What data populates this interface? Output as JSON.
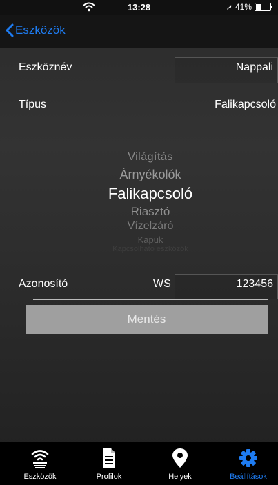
{
  "status_bar": {
    "time": "13:28",
    "battery_text": "41%",
    "battery_level": 0.41
  },
  "nav": {
    "back_label": "Eszközök"
  },
  "form": {
    "name_label": "Eszköznév",
    "name_value": "Nappali",
    "type_label": "Típus",
    "type_value": "Falikapcsoló",
    "id_label": "Azonosító",
    "id_prefix": "WS",
    "id_value": "123456",
    "save_label": "Mentés"
  },
  "picker": {
    "items": [
      "Világítás",
      "Árnyékolók",
      "Falikapcsoló",
      "Riasztó",
      "Vízelzáró",
      "Kapuk",
      "Kapcsolható eszközök"
    ],
    "selected": "Falikapcsoló"
  },
  "tabs": [
    {
      "label": "Eszközök",
      "icon": "wifi-signal-icon",
      "active": false
    },
    {
      "label": "Profilok",
      "icon": "document-icon",
      "active": false
    },
    {
      "label": "Helyek",
      "icon": "location-pin-icon",
      "active": false
    },
    {
      "label": "Beállítások",
      "icon": "gear-icon",
      "active": true
    }
  ],
  "colors": {
    "accent": "#1e7cf2",
    "background": "#2b2b2b",
    "save_button": "#9f9f9f"
  }
}
